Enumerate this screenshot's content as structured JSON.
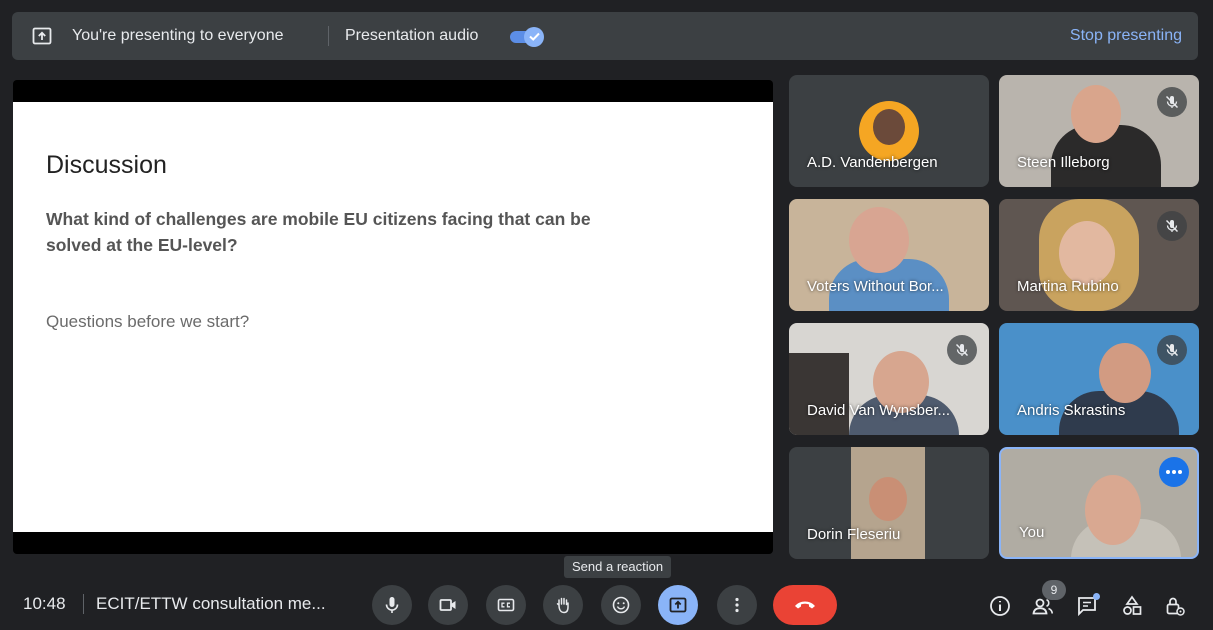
{
  "topbar": {
    "presenting_text": "You're presenting to everyone",
    "audio_label": "Presentation audio",
    "audio_enabled": true,
    "stop_label": "Stop presenting"
  },
  "slide": {
    "title": "Discussion",
    "question": "What kind of challenges are mobile EU citizens facing that can be solved at the EU-level?",
    "followup": "Questions before we start?"
  },
  "participants": [
    {
      "name": "A.D. Vandenbergen",
      "muted": false
    },
    {
      "name": "Steen Illeborg",
      "muted": true
    },
    {
      "name": "Voters Without Bor...",
      "muted": false
    },
    {
      "name": "Martina Rubino",
      "muted": true
    },
    {
      "name": "David Van Wynsber...",
      "muted": true
    },
    {
      "name": "Andris Skrastins",
      "muted": true
    },
    {
      "name": "Dorin Fleseriu",
      "muted": false
    },
    {
      "name": "You",
      "muted": false
    }
  ],
  "tooltip": "Send a reaction",
  "bottombar": {
    "time": "10:48",
    "meeting_title": "ECIT/ETTW consultation me...",
    "people_count": "9"
  },
  "colors": {
    "background": "#202124",
    "bar": "#3c4043",
    "accent": "#8ab4f8",
    "end_call": "#ea4335"
  }
}
